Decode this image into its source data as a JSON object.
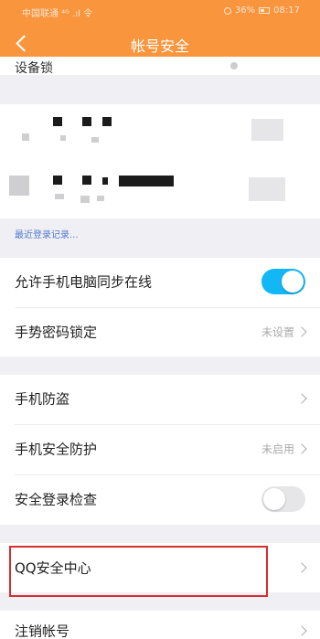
{
  "status_bar": {
    "carrier": "中国联通 ⁴ᴳ .ıl 令",
    "battery": "36%",
    "time": "08:17"
  },
  "header": {
    "title": "帐号安全",
    "back_icon": "chevron-left-icon"
  },
  "peek_row": {
    "label": "设备锁"
  },
  "recent_login_link": "最近登录记录...",
  "group1": [
    {
      "label": "允许手机电脑同步在线",
      "toggle": "on"
    },
    {
      "label": "手势密码锁定",
      "value": "未设置"
    }
  ],
  "group2": [
    {
      "label": "手机防盗"
    },
    {
      "label": "手机安全防护",
      "value": "未启用"
    },
    {
      "label": "安全登录检查",
      "toggle": "off"
    }
  ],
  "group3": [
    {
      "label": "QQ安全中心"
    }
  ],
  "group4": [
    {
      "label": "注销帐号"
    }
  ],
  "colors": {
    "header": "#f8953d",
    "toggle_on": "#12b7f5",
    "link": "#4f7bd1",
    "highlight": "#d62f2f"
  }
}
